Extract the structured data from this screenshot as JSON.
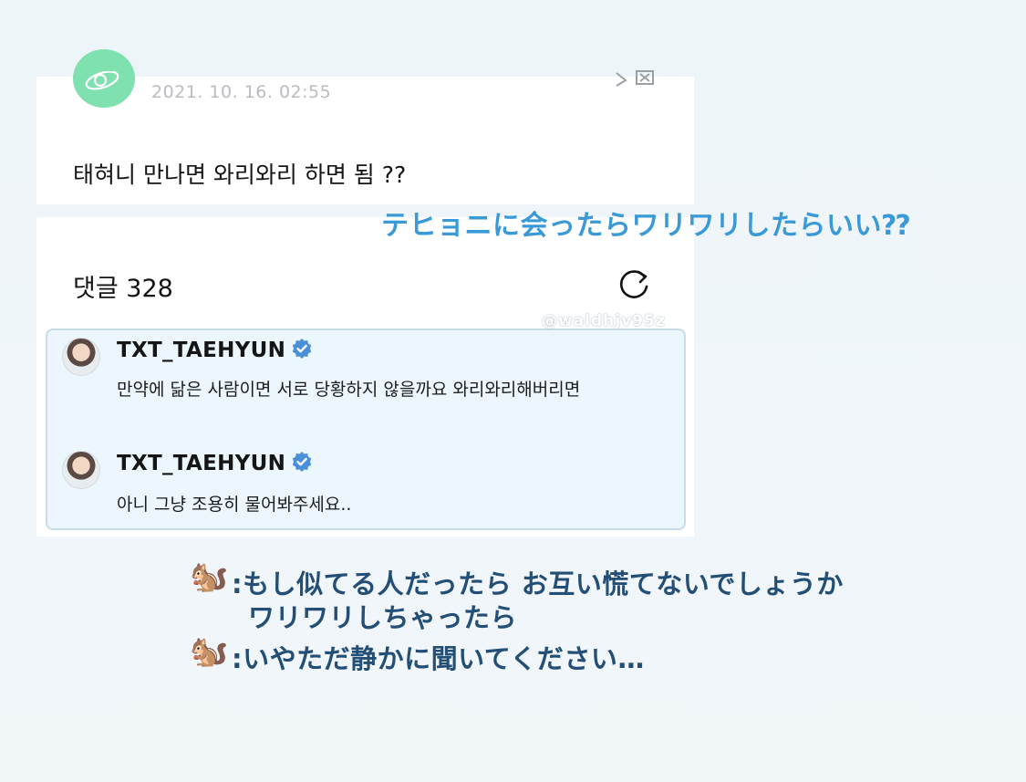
{
  "post": {
    "date": "2021. 10. 16. 02:55",
    "text": "태혀니 만나면 와리와리 하면 됨 ??"
  },
  "translation_post": "テヒョニに会ったらワリワリしたらいい⁇",
  "comments": {
    "title": "댓글 328",
    "replies": [
      {
        "name": "TXT_TAEHYUN",
        "text": "만약에 닮은 사람이면 서로 당황하지 않을까요 와리와리해버리면"
      },
      {
        "name": "TXT_TAEHYUN",
        "text": "아니 그냥 조용히 물어봐주세요.."
      }
    ]
  },
  "translation_replies": {
    "line1": ":もし似てる人だったら お互い慌てないでしょうか",
    "line2": "ワリワリしちゃったら",
    "line3": ":いやただ静かに聞いてください…"
  },
  "watermark": "@waldhjv95z",
  "icons": {
    "squirrel": "🐿️",
    "accent": "#3a9ad8",
    "translation_color": "#234e76"
  }
}
